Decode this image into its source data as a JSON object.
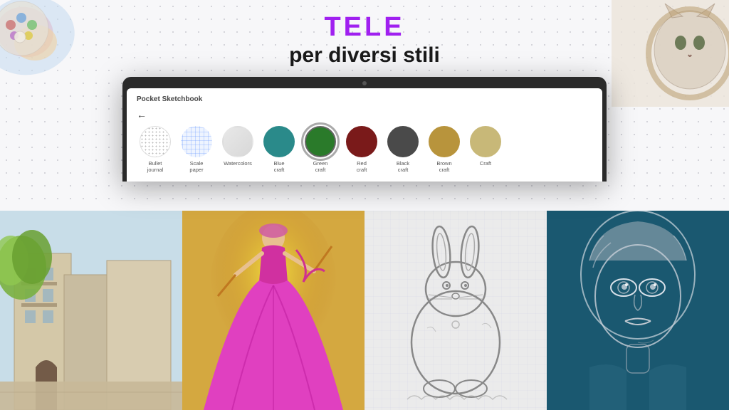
{
  "header": {
    "title_accent": "TELE",
    "title_main": "per diversi stili"
  },
  "app": {
    "name": "Pocket Sketchbook",
    "back_arrow": "←"
  },
  "canvas_options": [
    {
      "id": "bullet",
      "label": "Bullet\njournal",
      "style": "bullet",
      "selected": false
    },
    {
      "id": "scale",
      "label": "Scale\npaper",
      "style": "scale",
      "selected": false
    },
    {
      "id": "watercolor",
      "label": "Watercolors",
      "style": "watercolor",
      "selected": false
    },
    {
      "id": "blue",
      "label": "Blue\ncraft",
      "style": "blue",
      "selected": false
    },
    {
      "id": "green",
      "label": "Green\ncraft",
      "style": "green",
      "selected": true
    },
    {
      "id": "red",
      "label": "Red\ncraft",
      "style": "red",
      "selected": false
    },
    {
      "id": "black",
      "label": "Black\ncraft",
      "style": "black",
      "selected": false
    },
    {
      "id": "brown",
      "label": "Brown\ncraft",
      "style": "brown",
      "selected": false
    },
    {
      "id": "craft",
      "label": "Craft",
      "style": "craft",
      "selected": false
    }
  ],
  "artworks": [
    {
      "id": "street",
      "description": "Street scene painting"
    },
    {
      "id": "fashion",
      "description": "Fashion figure in purple dress"
    },
    {
      "id": "rabbit",
      "description": "Rabbit sketch on grid paper"
    },
    {
      "id": "portrait",
      "description": "Portrait sketch on dark background"
    }
  ]
}
